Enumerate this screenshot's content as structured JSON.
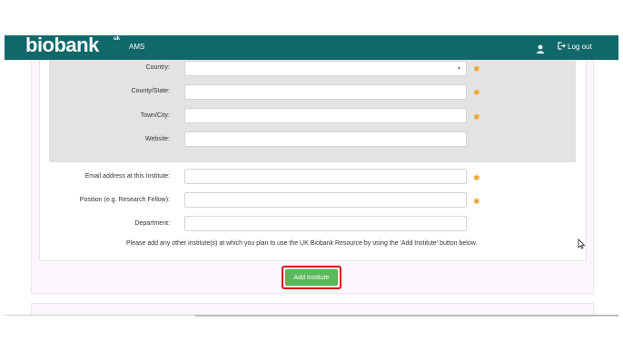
{
  "header": {
    "logo_text": "biobank",
    "logo_suffix": "uk",
    "app_label": "AMS",
    "logout_label": "Log out"
  },
  "form": {
    "fields": [
      {
        "label": "Country:",
        "required": true
      },
      {
        "label": "County/State:",
        "required": true
      },
      {
        "label": "Town/City:",
        "required": true
      },
      {
        "label": "Website:",
        "required": false
      },
      {
        "label": "Email address at this Institute:",
        "required": true
      },
      {
        "label": "Position (e.g. Research Fellow):",
        "required": true
      },
      {
        "label": "Department:",
        "required": false
      }
    ],
    "required_marker": "✱",
    "notice": "Please add any other institute(s) at which you plan to use the UK Biobank Resource by using the 'Add Institute' button below.",
    "add_button_label": "Add Institute"
  },
  "colors": {
    "navbar": "#11686b",
    "required": "#f0a020",
    "add_button": "#5cb85c",
    "highlight": "#d01a1a"
  },
  "icons": {
    "user": "user-icon",
    "logout": "logout-icon",
    "select": "chevron-down-icon"
  }
}
